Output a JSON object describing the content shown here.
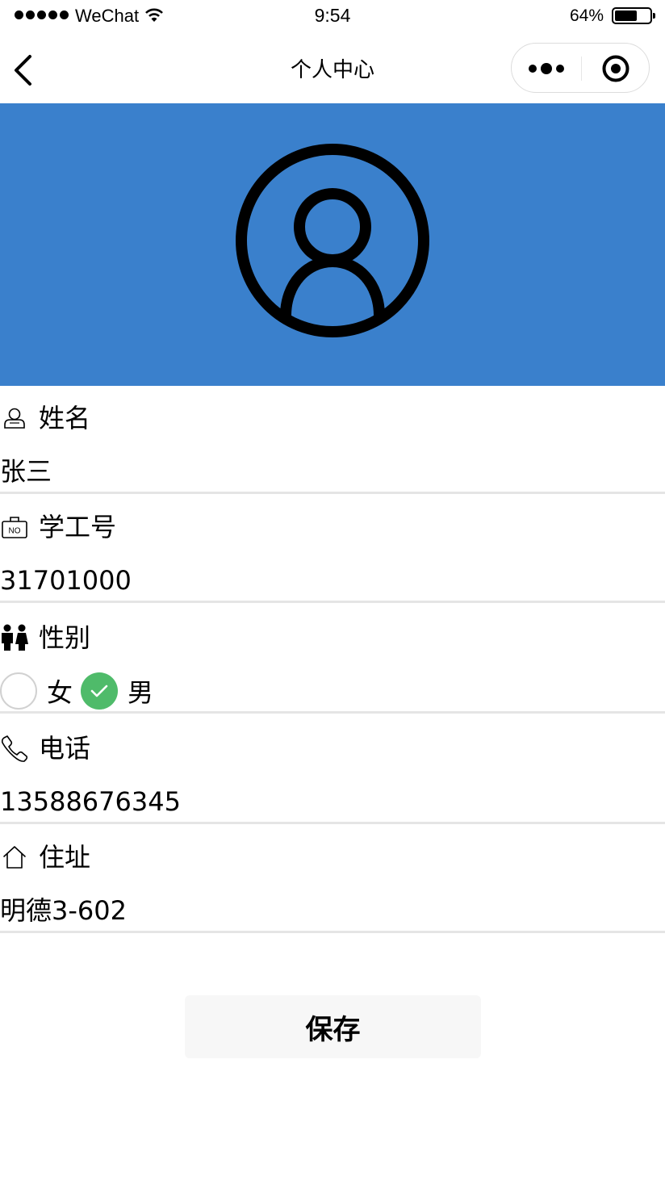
{
  "status_bar": {
    "carrier": "WeChat",
    "time": "9:54",
    "battery_percent_label": "64%",
    "battery_level": 0.64
  },
  "nav": {
    "title": "个人中心"
  },
  "header": {
    "background_color": "#3a80cc",
    "avatar_icon": "user-circle-icon"
  },
  "form": {
    "name": {
      "label": "姓名",
      "value": "张三",
      "icon": "user-icon"
    },
    "student_id": {
      "label": "学工号",
      "value": "31701000",
      "icon": "id-badge-icon"
    },
    "gender": {
      "label": "性别",
      "icon": "people-icon",
      "options": [
        {
          "label": "女",
          "checked": false
        },
        {
          "label": "男",
          "checked": true
        }
      ]
    },
    "phone": {
      "label": "电话",
      "value": "13588676345",
      "icon": "phone-icon"
    },
    "address": {
      "label": "住址",
      "value": "明德3-602",
      "icon": "home-icon"
    }
  },
  "save_button": {
    "label": "保存"
  },
  "colors": {
    "accent_green": "#4fbb6a",
    "divider": "#e5e5e5"
  }
}
